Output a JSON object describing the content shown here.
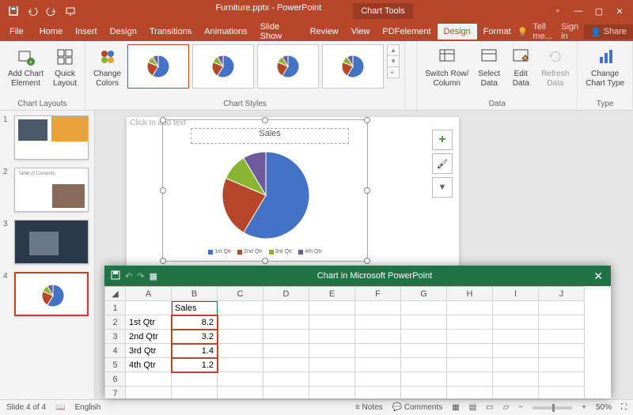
{
  "app": {
    "title_document": "Furniture.pptx - PowerPoint",
    "title_contextual": "Chart Tools"
  },
  "menu": {
    "file": "File",
    "home": "Home",
    "insert": "Insert",
    "design_main": "Design",
    "transitions": "Transitions",
    "animations": "Animations",
    "slideshow": "Slide Show",
    "review": "Review",
    "view": "View",
    "pdf": "PDFelement",
    "design": "Design",
    "format": "Format",
    "tellme": "Tell me...",
    "signin": "Sign in",
    "share": "Share"
  },
  "ribbon": {
    "group_layouts": "Chart Layouts",
    "btn_add_element": "Add Chart\nElement",
    "btn_quick_layout": "Quick\nLayout",
    "btn_change_colors": "Change\nColors",
    "group_styles": "Chart Styles",
    "group_data": "Data",
    "btn_switch": "Switch Row/\nColumn",
    "btn_select": "Select\nData",
    "btn_edit": "Edit\nData",
    "btn_refresh": "Refresh\nData",
    "group_type": "Type",
    "btn_change_type": "Change\nChart Type"
  },
  "slides": {
    "count": 4,
    "active": 4
  },
  "chart": {
    "placeholder": "Click to add text",
    "title": "Sales"
  },
  "chart_data": {
    "type": "pie",
    "title": "Sales",
    "categories": [
      "1st Qtr",
      "2nd Qtr",
      "3rd Qtr",
      "4th Qtr"
    ],
    "values": [
      8.2,
      3.2,
      1.4,
      1.2
    ],
    "colors": [
      "#4472c4",
      "#b7472a",
      "#8ab532",
      "#6f5a9b"
    ]
  },
  "excel": {
    "title": "Chart in Microsoft PowerPoint",
    "columns": [
      "A",
      "B",
      "C",
      "D",
      "E",
      "F",
      "G",
      "H",
      "I",
      "J"
    ],
    "header_cell": "Sales",
    "rows": [
      {
        "r": "1",
        "a": "",
        "b": "Sales"
      },
      {
        "r": "2",
        "a": "1st Qtr",
        "b": "8.2"
      },
      {
        "r": "3",
        "a": "2nd Qtr",
        "b": "3.2"
      },
      {
        "r": "4",
        "a": "3rd Qtr",
        "b": "1.4"
      },
      {
        "r": "5",
        "a": "4th Qtr",
        "b": "1.2"
      },
      {
        "r": "6",
        "a": "",
        "b": ""
      },
      {
        "r": "7",
        "a": "",
        "b": ""
      }
    ]
  },
  "status": {
    "slide": "Slide 4 of 4",
    "lang": "English",
    "notes": "Notes",
    "comments": "Comments",
    "zoom": "50%"
  }
}
